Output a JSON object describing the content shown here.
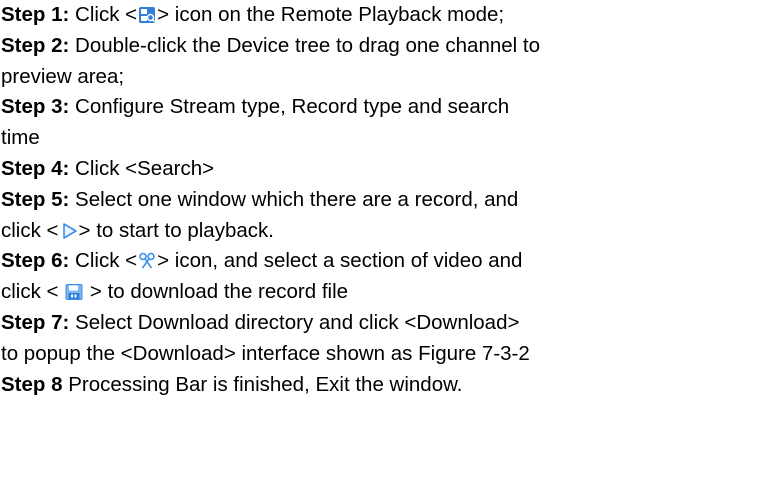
{
  "steps": [
    {
      "label": "Step 1:",
      "lines": [
        {
          "before": " Click <",
          "icon": "remote-playback-search-icon",
          "after": "> icon on the Remote Playback mode;"
        }
      ]
    },
    {
      "label": "Step 2:",
      "lines": [
        {
          "before": " Double-click the Device tree to drag one channel to"
        },
        {
          "before": "preview area;"
        }
      ]
    },
    {
      "label": "Step 3:",
      "lines": [
        {
          "before": " Configure Stream type, Record type and search"
        },
        {
          "before": "time"
        }
      ]
    },
    {
      "label": "Step 4:",
      "lines": [
        {
          "before": " Click <Search>"
        }
      ]
    },
    {
      "label": "Step 5:",
      "lines": [
        {
          "before": " Select one window which there are a record, and"
        },
        {
          "before": "click <",
          "icon": "play-icon",
          "after": "> to start to playback."
        }
      ]
    },
    {
      "label": "Step 6:",
      "lines": [
        {
          "before": " Click <",
          "icon": "scissors-icon",
          "after": "> icon, and select a section of video and"
        },
        {
          "before": "click < ",
          "icon": "save-icon",
          "after": " > to download the record file"
        }
      ]
    },
    {
      "label": "Step 7:",
      "lines": [
        {
          "before": " Select Download directory and click <Download>"
        },
        {
          "before": "to popup the <Download> interface shown as Figure 7-3-2"
        }
      ]
    },
    {
      "label": "Step 8",
      "lines": [
        {
          "before": " Processing Bar is finished, Exit the window."
        }
      ]
    }
  ]
}
